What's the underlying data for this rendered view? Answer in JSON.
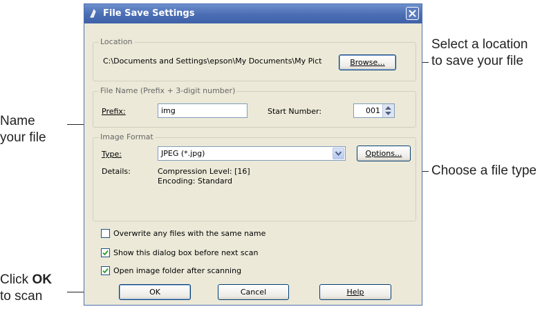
{
  "dialog": {
    "title": "File Save Settings",
    "location": {
      "legend": "Location",
      "path": "C:\\Documents and Settings\\epson\\My Documents\\My Pict",
      "browse_label": "Browse..."
    },
    "file_name": {
      "legend": "File Name (Prefix + 3-digit number)",
      "prefix_label": "Prefix:",
      "prefix_value": "img",
      "start_number_label": "Start Number:",
      "start_number_value": "001"
    },
    "image_format": {
      "legend": "Image Format",
      "type_label": "Type:",
      "type_value": "JPEG (*.jpg)",
      "options_label": "Options...",
      "details_label": "Details:",
      "details_line1": "Compression Level: [16]",
      "details_line2": "Encoding: Standard"
    },
    "checkboxes": [
      {
        "label": "Overwrite any files with the same name",
        "checked": false
      },
      {
        "label": "Show this dialog box before next scan",
        "checked": true
      },
      {
        "label": "Open image folder after scanning",
        "checked": true
      }
    ],
    "buttons": {
      "ok": "OK",
      "cancel": "Cancel",
      "help": "Help"
    }
  },
  "callouts": {
    "location": {
      "line1": "Select a location",
      "line2": "to save your file"
    },
    "name": {
      "line1": "Name",
      "line2": "your file"
    },
    "type": "Choose a file type",
    "ok": {
      "prefix": "Click ",
      "bold": "OK",
      "line2": "to scan"
    }
  }
}
